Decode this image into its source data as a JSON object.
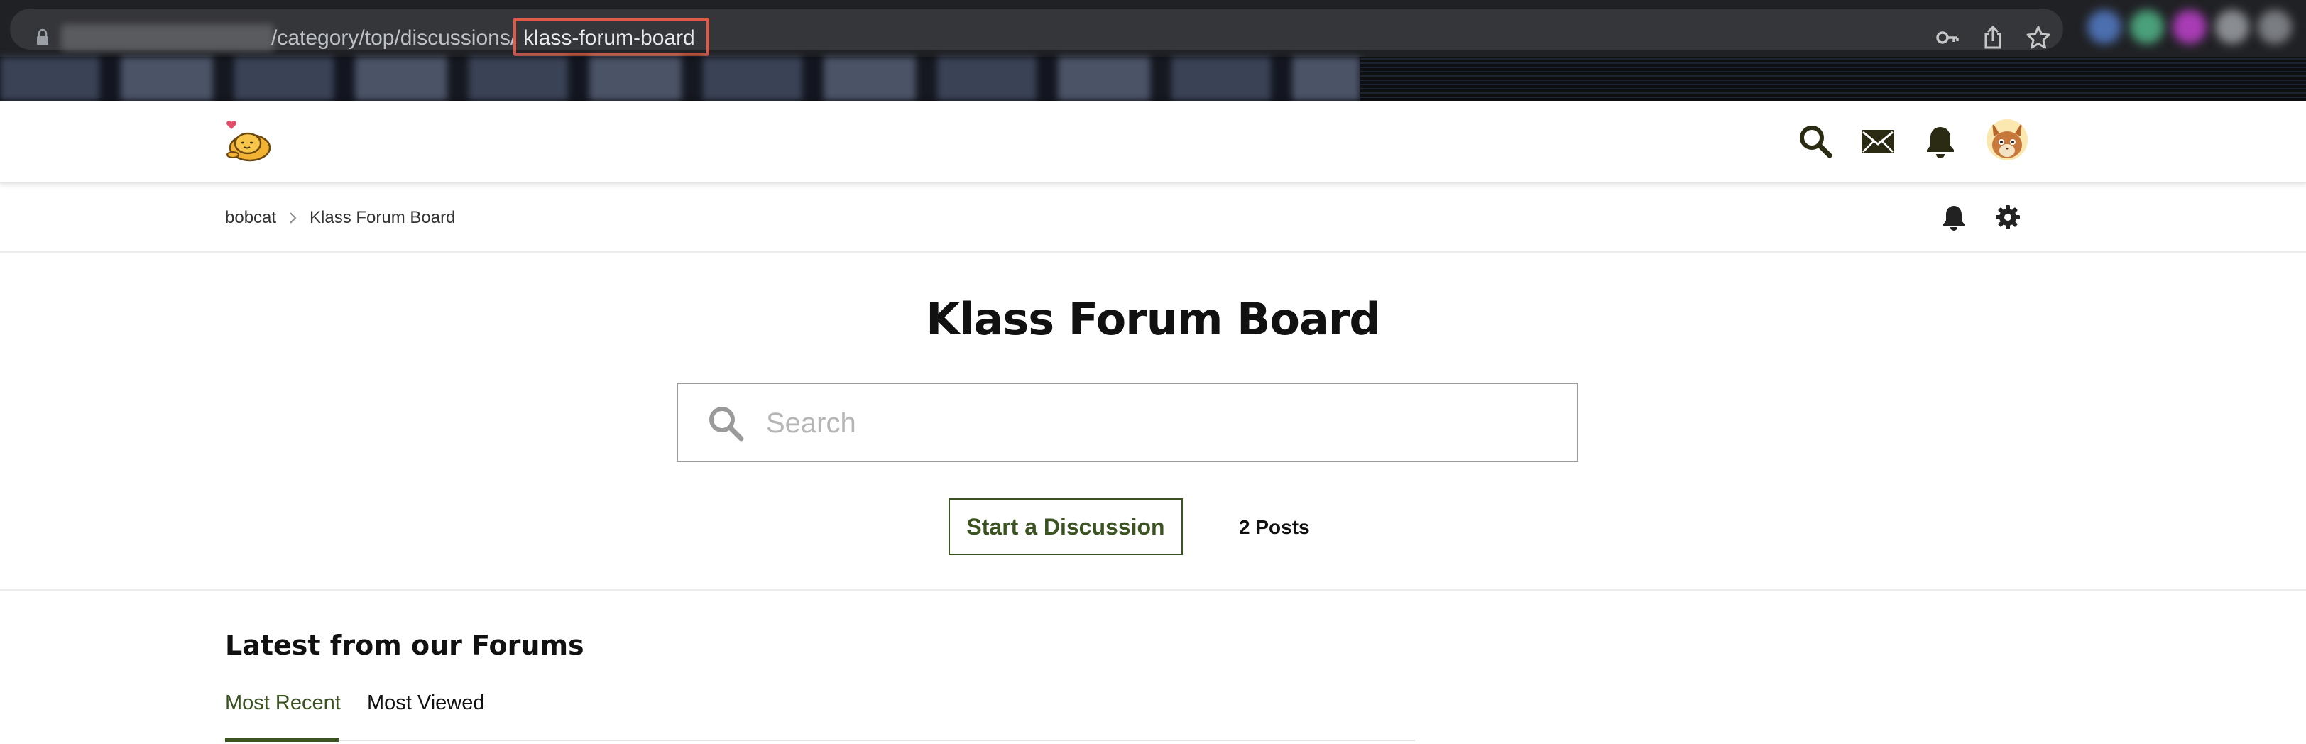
{
  "browser": {
    "url_visible": "/category/top/discussions/",
    "url_highlighted": "klass-forum-board"
  },
  "breadcrumb": {
    "items": [
      {
        "label": "bobcat"
      },
      {
        "label": "Klass Forum Board"
      }
    ]
  },
  "hero": {
    "title": "Klass Forum Board",
    "search_placeholder": "Search",
    "start_button": "Start a Discussion",
    "posts_count": "2 Posts"
  },
  "latest": {
    "title": "Latest from our Forums",
    "tabs": [
      {
        "label": "Most Recent",
        "active": true
      },
      {
        "label": "Most Viewed",
        "active": false
      }
    ]
  },
  "colors": {
    "accent_green": "#3a5320",
    "highlight_red": "#e05a47",
    "chrome_dark": "#202124"
  },
  "icons": {
    "header": [
      "search-icon",
      "mail-icon",
      "bell-icon",
      "avatar"
    ],
    "breadcrumb": [
      "bell-icon",
      "gear-icon"
    ]
  }
}
